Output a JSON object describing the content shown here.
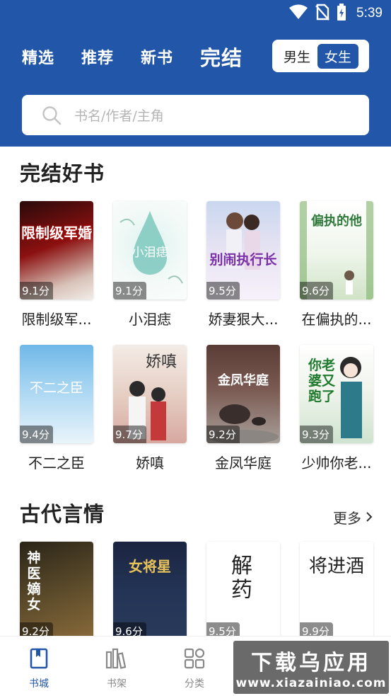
{
  "status": {
    "time": "5:39"
  },
  "nav": {
    "tabs": [
      {
        "label": "精选"
      },
      {
        "label": "推荐"
      },
      {
        "label": "新书"
      },
      {
        "label": "完结"
      }
    ],
    "active_tab": "完结",
    "gender": {
      "male": "男生",
      "female": "女生",
      "selected": "女生"
    }
  },
  "search": {
    "placeholder": "书名/作者/主角"
  },
  "sections": [
    {
      "title": "完结好书",
      "books": [
        {
          "name": "限制级军...",
          "score": "9.1分",
          "cover_text": "限制级军婚"
        },
        {
          "name": "小泪痣",
          "score": "9.1分",
          "cover_text": "小泪痣"
        },
        {
          "name": "娇妻狠大...",
          "score": "9.5分",
          "cover_text": "别闹执行长"
        },
        {
          "name": "在偏执的...",
          "score": "9.6分",
          "cover_text": "偏执的他"
        },
        {
          "name": "不二之臣",
          "score": "9.4分",
          "cover_text": "不二之臣"
        },
        {
          "name": "娇嗔",
          "score": "9.7分",
          "cover_text": "娇嗔"
        },
        {
          "name": "金凤华庭",
          "score": "9.2分",
          "cover_text": "金凤华庭"
        },
        {
          "name": "少帅你老...",
          "score": "9.3分",
          "cover_text": "你老婆又跑了"
        }
      ]
    },
    {
      "title": "古代言情",
      "more": "更多",
      "books": [
        {
          "score": "9.2分",
          "cover_text": "神医嫡女"
        },
        {
          "score": "9.6分",
          "cover_text": "女将星"
        },
        {
          "score": "9.5分",
          "cover_text": "解药"
        },
        {
          "score": "9.9分",
          "cover_text": "将进酒"
        }
      ]
    }
  ],
  "bottom_nav": [
    {
      "label": "书城",
      "icon": "book-icon",
      "active": true
    },
    {
      "label": "书架",
      "icon": "bookshelf-icon",
      "active": false
    },
    {
      "label": "分类",
      "icon": "category-icon",
      "active": false
    }
  ],
  "watermark": {
    "main": "下载乌应用",
    "sub": "www.xiazainiao.com"
  },
  "colors": {
    "brand": "#2156a8",
    "text": "#222222",
    "muted": "#888888"
  }
}
